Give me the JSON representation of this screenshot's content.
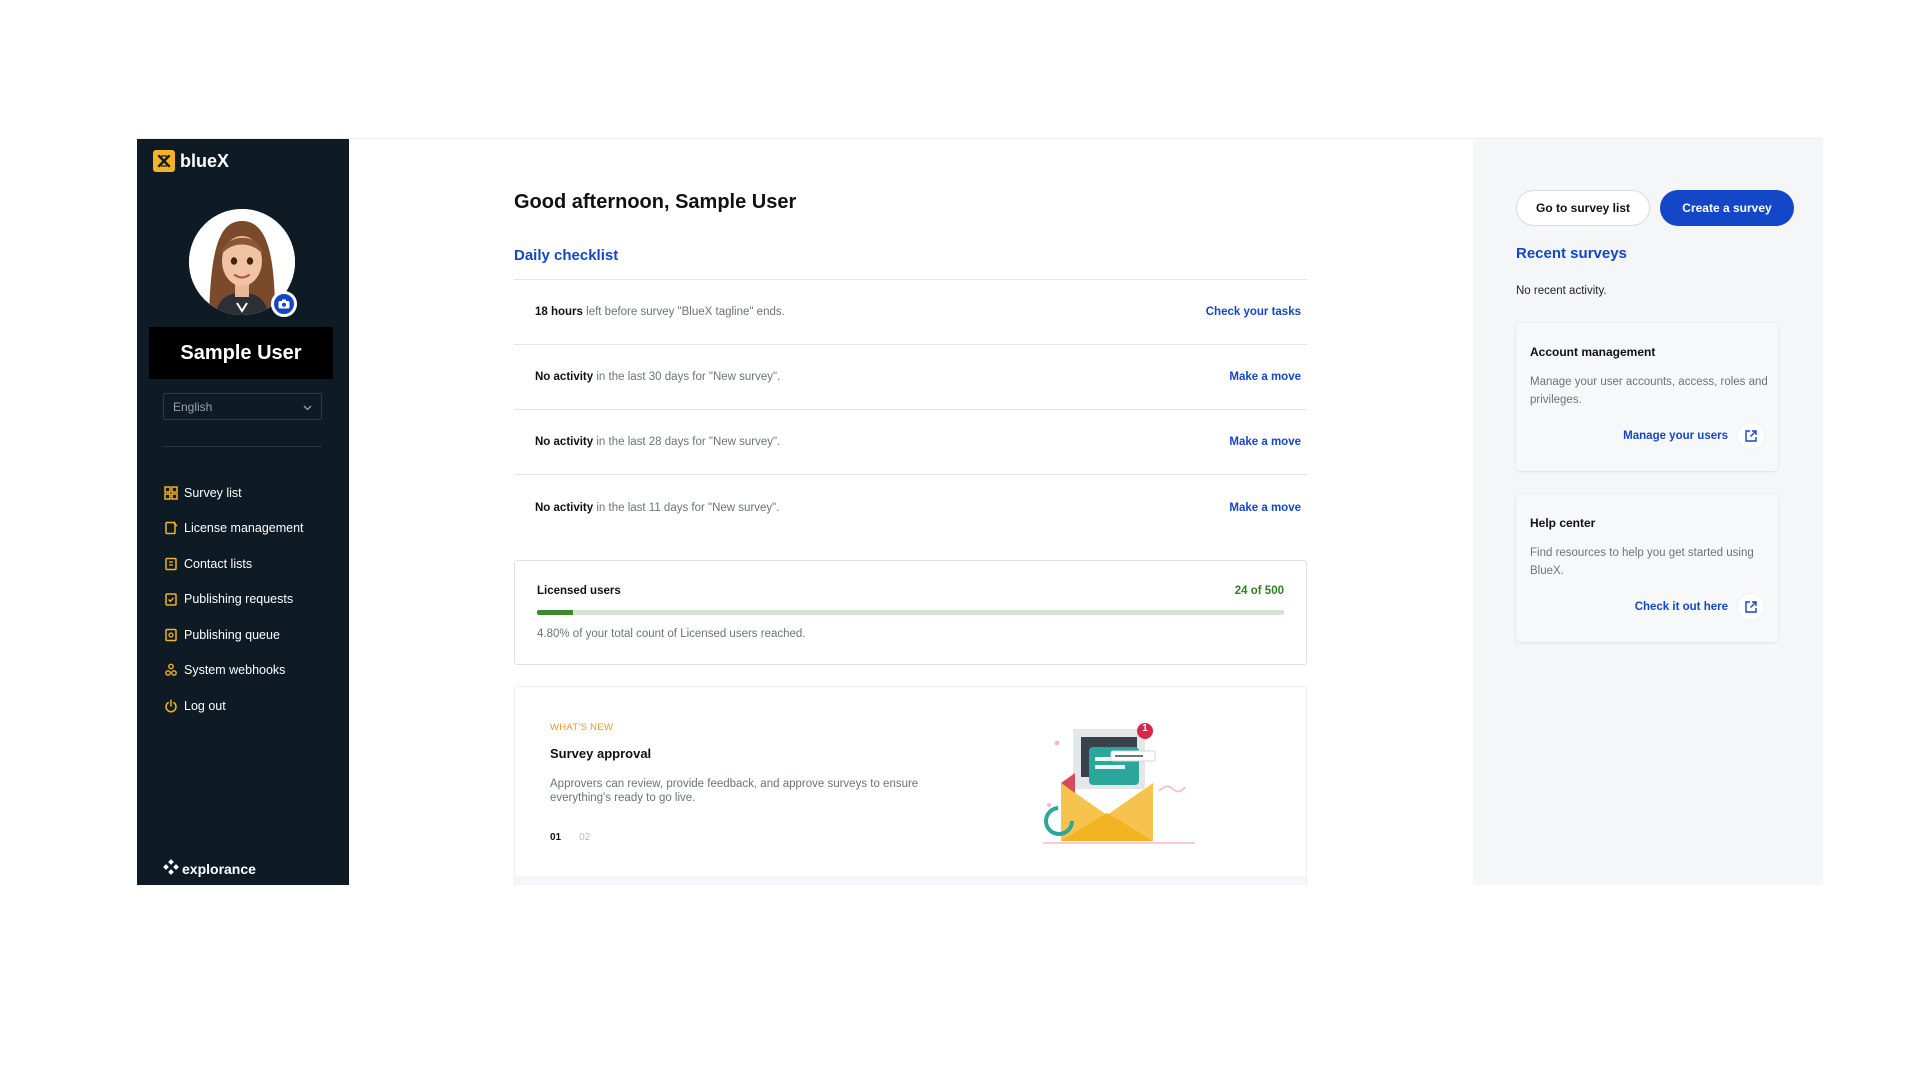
{
  "brand": {
    "name": "blueX",
    "accent": "#f3b322"
  },
  "user": {
    "name": "Sample User"
  },
  "language": {
    "selected": "English"
  },
  "nav": [
    {
      "label": "Survey list",
      "icon": "grid-icon"
    },
    {
      "label": "License management",
      "icon": "license-icon"
    },
    {
      "label": "Contact lists",
      "icon": "contacts-icon"
    },
    {
      "label": "Publishing requests",
      "icon": "clipboard-check-icon"
    },
    {
      "label": "Publishing queue",
      "icon": "queue-icon"
    },
    {
      "label": "System webhooks",
      "icon": "webhook-icon"
    },
    {
      "label": "Log out",
      "icon": "power-icon"
    }
  ],
  "footer_brand": "explorance",
  "main": {
    "greeting": "Good afternoon, Sample User",
    "checklist_title": "Daily checklist",
    "checklist": [
      {
        "bold": "18 hours",
        "rest": " left before survey \"BlueX tagline\" ends.",
        "action": "Check your tasks"
      },
      {
        "bold": "No activity",
        "rest": " in the last 30 days for \"New survey\".",
        "action": "Make a move"
      },
      {
        "bold": "No activity",
        "rest": " in the last 28 days for \"New survey\".",
        "action": "Make a move"
      },
      {
        "bold": "No activity",
        "rest": " in the last 11 days for \"New survey\".",
        "action": "Make a move"
      }
    ],
    "licensed": {
      "label": "Licensed users",
      "count": "24 of 500",
      "progress": 0.048,
      "note": "4.80% of your total count of Licensed users reached."
    },
    "whats_new": {
      "eyebrow": "WHAT'S NEW",
      "title": "Survey approval",
      "description": "Approvers can review, provide feedback, and approve surveys to ensure everything's ready to go live.",
      "pages": [
        "01",
        "02"
      ],
      "current_page": "01",
      "badge": "1"
    }
  },
  "right": {
    "go_to_list": "Go to survey list",
    "create": "Create a survey",
    "recent_title": "Recent surveys",
    "recent_empty": "No recent activity.",
    "cards": [
      {
        "title": "Account management",
        "description": "Manage your user accounts, access, roles and privileges.",
        "link": "Manage your users"
      },
      {
        "title": "Help center",
        "description": "Find resources to help you get started using BlueX.",
        "link": "Check it out here"
      }
    ]
  },
  "colors": {
    "primary": "#1446c8",
    "sidebar": "#0e1a24",
    "success": "#3d8a2e",
    "warning": "#e39a2a"
  }
}
